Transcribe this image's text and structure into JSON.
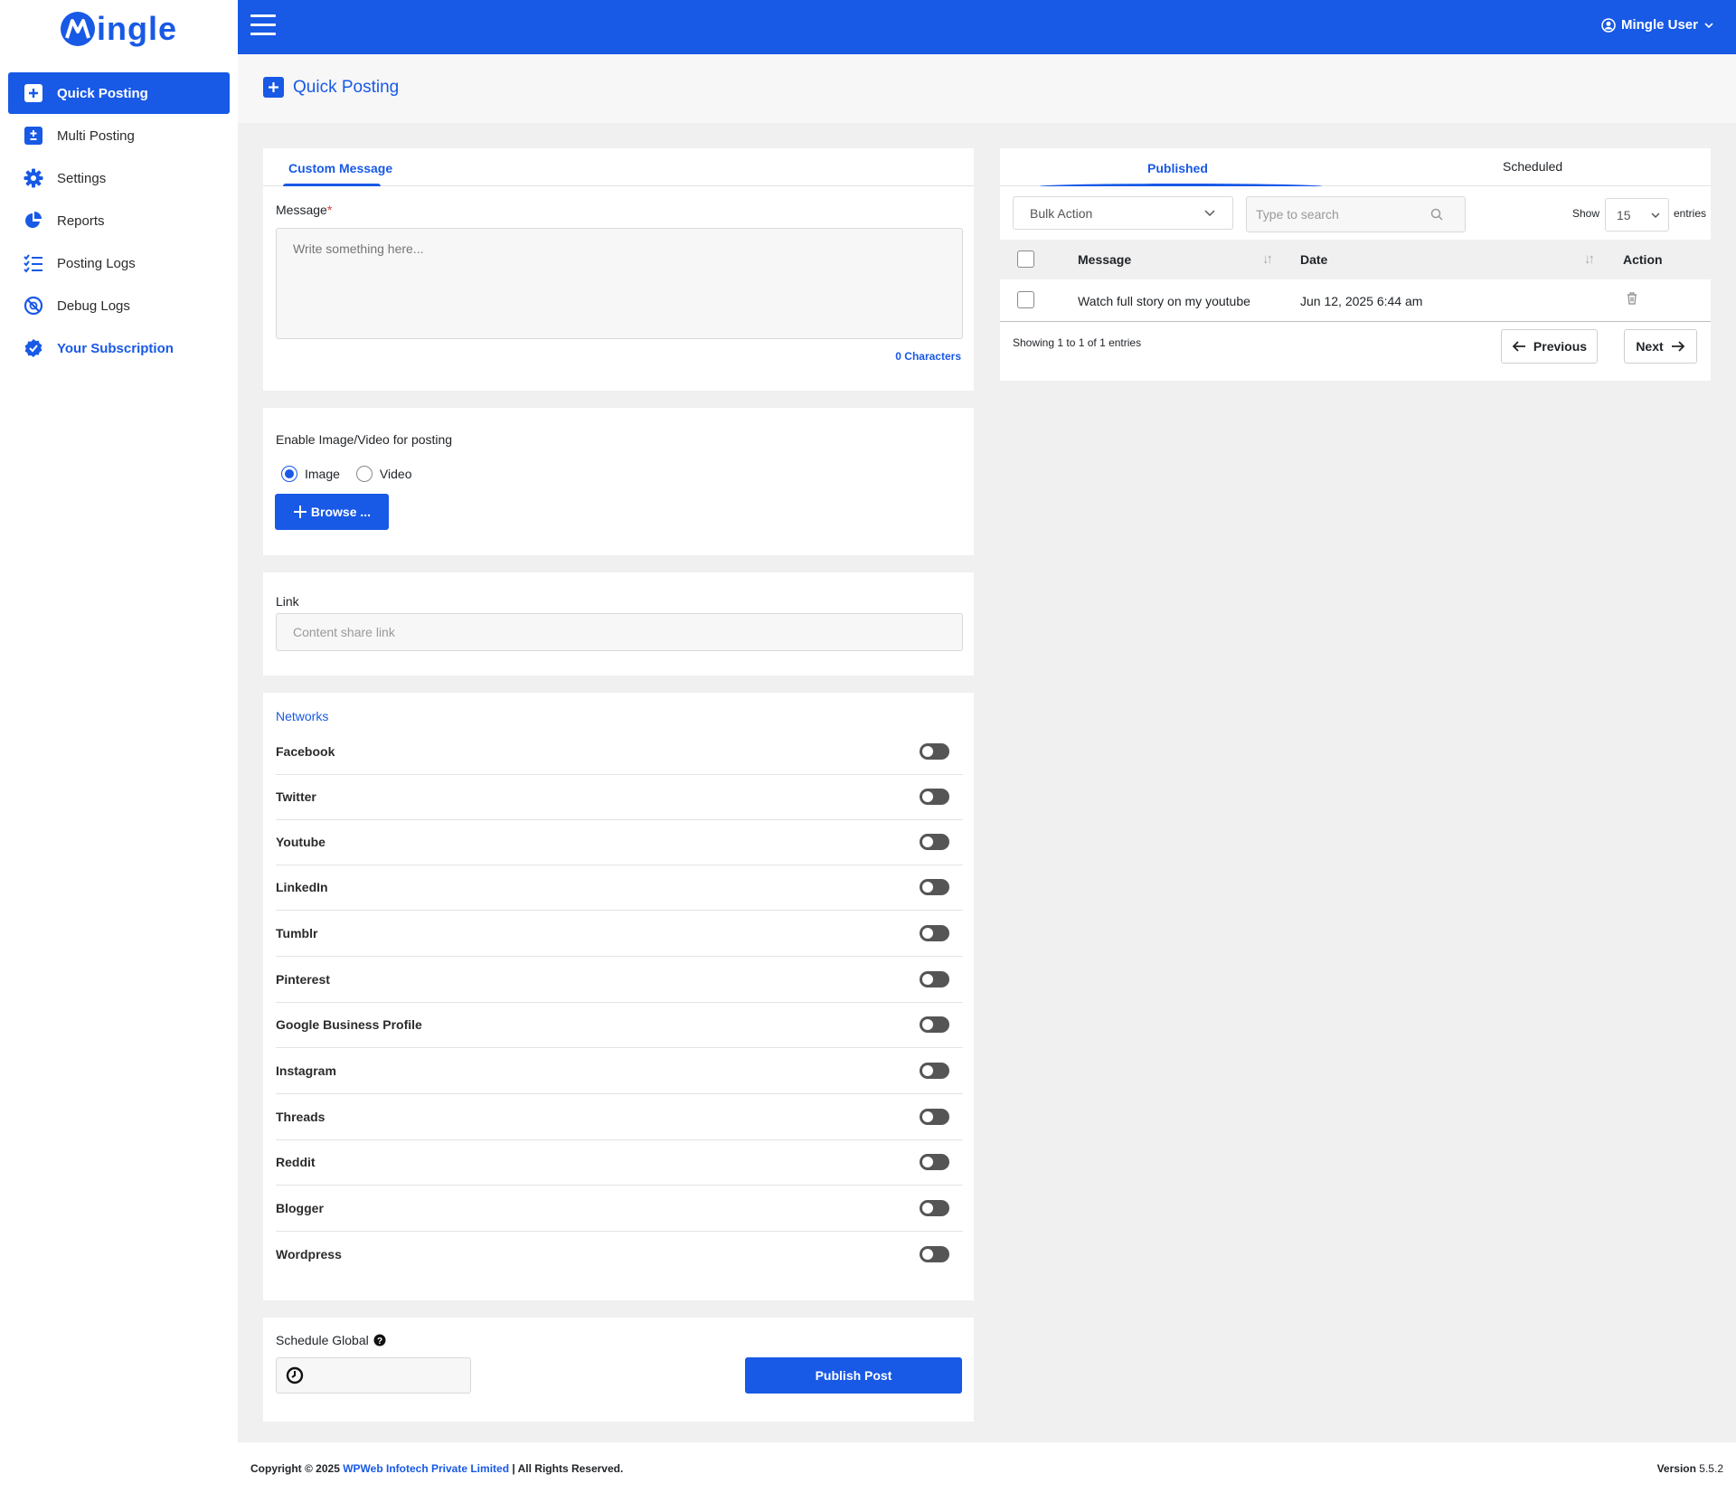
{
  "brand": {
    "name": "ingle"
  },
  "sidebar": {
    "items": [
      {
        "label": "Quick Posting"
      },
      {
        "label": "Multi Posting"
      },
      {
        "label": "Settings"
      },
      {
        "label": "Reports"
      },
      {
        "label": "Posting Logs"
      },
      {
        "label": "Debug Logs"
      },
      {
        "label": "Your Subscription"
      }
    ]
  },
  "header": {
    "user": "Mingle User"
  },
  "page": {
    "title": "Quick Posting"
  },
  "composer": {
    "tab": "Custom Message",
    "message_label": "Message",
    "required_mark": "*",
    "message_placeholder": "Write something here...",
    "char_count": "0 Characters"
  },
  "media": {
    "label": "Enable Image/Video for posting",
    "options": [
      "Image",
      "Video"
    ],
    "selected": "Image",
    "browse_label": "Browse ..."
  },
  "link": {
    "label": "Link",
    "placeholder": "Content share link"
  },
  "networks": {
    "title": "Networks",
    "items": [
      "Facebook",
      "Twitter",
      "Youtube",
      "LinkedIn",
      "Tumblr",
      "Pinterest",
      "Google Business Profile",
      "Instagram",
      "Threads",
      "Reddit",
      "Blogger",
      "Wordpress"
    ]
  },
  "schedule": {
    "label": "Schedule Global",
    "publish_label": "Publish Post"
  },
  "posts": {
    "tabs": [
      "Published",
      "Scheduled"
    ],
    "bulk_action": "Bulk Action",
    "search_placeholder": "Type to search",
    "show_label": "Show",
    "entries_value": "15",
    "entries_label": "entries",
    "columns": [
      "Message",
      "Date",
      "Action"
    ],
    "rows": [
      {
        "message": "Watch full story on my youtube",
        "date": "Jun 12, 2025 6:44 am"
      }
    ],
    "summary": "Showing 1 to 1 of 1 entries",
    "prev_label": "Previous",
    "next_label": "Next"
  },
  "footer": {
    "copyright_prefix": "Copyright © 2025",
    "company": "WPWeb Infotech Private Limited",
    "copyright_suffix": "| All Rights Reserved.",
    "version_label": "Version",
    "version": "5.5.2"
  },
  "colors": {
    "primary": "#1859e6",
    "background": "#f0f0f0"
  }
}
